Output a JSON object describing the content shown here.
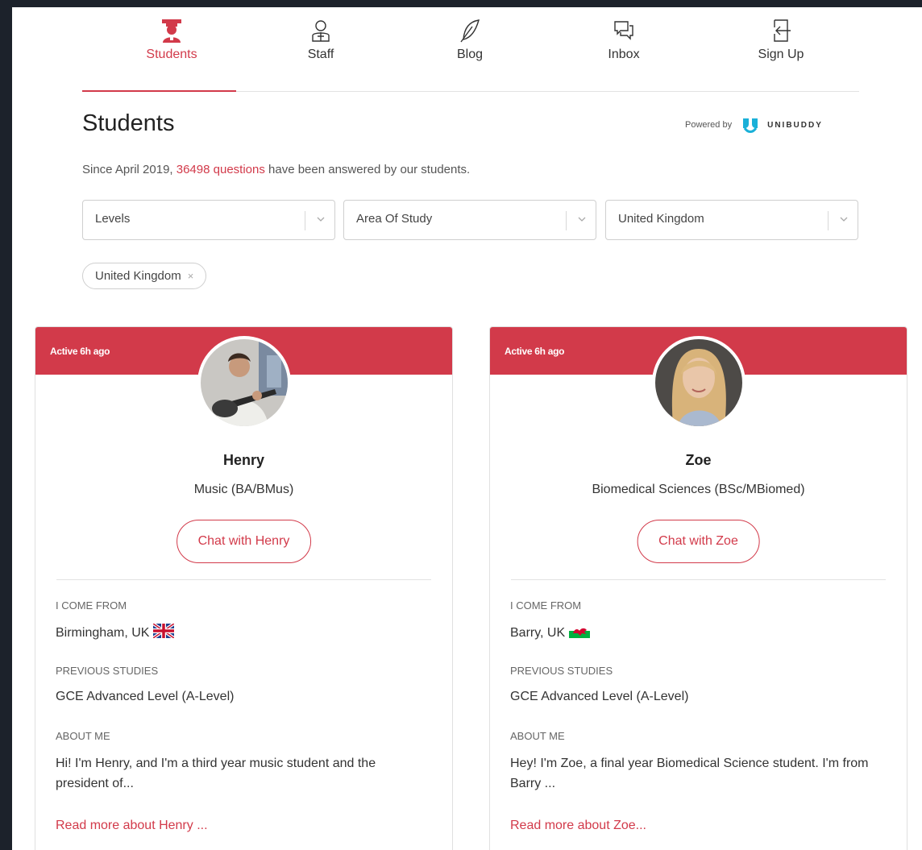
{
  "nav": {
    "items": [
      {
        "label": "Students",
        "icon": "graduate-icon"
      },
      {
        "label": "Staff",
        "icon": "staff-icon"
      },
      {
        "label": "Blog",
        "icon": "feather-icon"
      },
      {
        "label": "Inbox",
        "icon": "chat-bubbles-icon"
      },
      {
        "label": "Sign Up",
        "icon": "sign-in-icon"
      }
    ],
    "active": "Students"
  },
  "header": {
    "title": "Students",
    "powered_by": "Powered by",
    "brand": "UNIBUDDY"
  },
  "subtitle": {
    "prefix": "Since April 2019,",
    "highlight": "36498 questions",
    "suffix": "have been answered by our students."
  },
  "filters": [
    {
      "label": "Levels"
    },
    {
      "label": "Area Of Study"
    },
    {
      "label": "United Kingdom"
    }
  ],
  "active_chip": {
    "label": "United Kingdom",
    "remove": "×"
  },
  "accent_color": "#d23a4a",
  "cards": [
    {
      "status": "Active 6h ago",
      "name": "Henry",
      "course": "Music (BA/BMus)",
      "chat_label": "Chat with Henry",
      "from_label": "I COME FROM",
      "from_value": "Birmingham, UK",
      "flag": "uk-flag-icon",
      "prev_label": "PREVIOUS STUDIES",
      "prev_value": "GCE Advanced Level (A-Level)",
      "about_label": "ABOUT ME",
      "about_value": "Hi! I'm Henry, and I'm a third year music student and the president of...",
      "more": "Read more about Henry ..."
    },
    {
      "status": "Active 6h ago",
      "name": "Zoe",
      "course": "Biomedical Sciences (BSc/MBiomed)",
      "chat_label": "Chat with Zoe",
      "from_label": "I COME FROM",
      "from_value": "Barry, UK",
      "flag": "wales-flag-icon",
      "prev_label": "PREVIOUS STUDIES",
      "prev_value": "GCE Advanced Level (A-Level)",
      "about_label": "ABOUT ME",
      "about_value": "Hey! I'm Zoe, a final year Biomedical Science student. I'm from Barry ...",
      "more": "Read more about Zoe..."
    }
  ]
}
